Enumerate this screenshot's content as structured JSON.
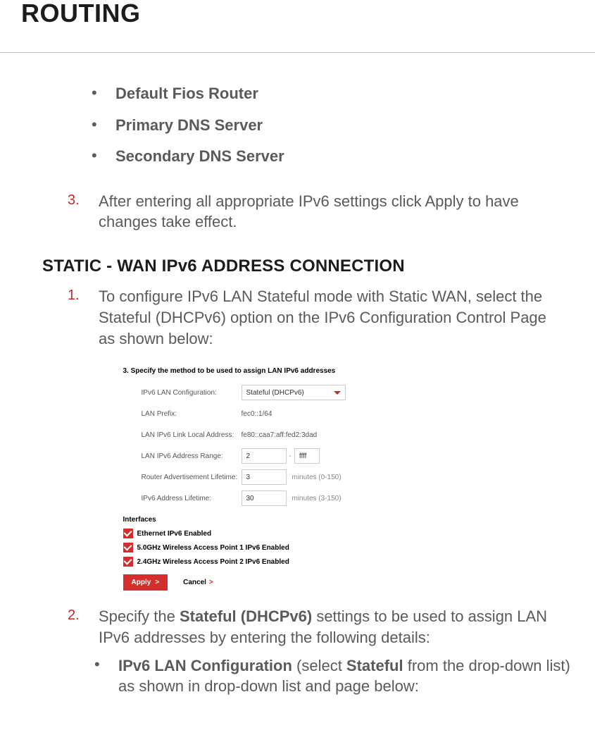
{
  "title": "ROUTING",
  "top_bullets": [
    "Default Fios Router",
    "Primary DNS Server",
    "Secondary DNS Server"
  ],
  "step3_num": "3.",
  "step3_text": "After entering all appropriate IPv6 settings click Apply to have changes take effect.",
  "subhead": "STATIC - WAN IPv6 ADDRESS CONNECTION",
  "step1_num": "1.",
  "step1_text": "To configure IPv6 LAN Stateful mode with Static WAN, select the Stateful (DHCPv6) option on the IPv6 Configuration Control Page as shown below:",
  "figure": {
    "title": "3. Specify the method to be used to assign LAN IPv6 addresses",
    "row_ipv6cfg_label": "IPv6 LAN Configuration:",
    "row_ipv6cfg_value": "Stateful (DHCPv6)",
    "row_lanprefix_label": "LAN Prefix:",
    "row_lanprefix_value": "fec0::1/64",
    "row_linklocal_label": "LAN IPv6 Link Local Address:",
    "row_linklocal_value": "fe80::caa7:aff:fed2:3dad",
    "row_range_label": "LAN IPv6 Address Range:",
    "row_range_start": "2",
    "row_range_end": "ffff",
    "row_ra_label": "Router Advertisement Lifetime:",
    "row_ra_value": "3",
    "row_ra_hint": "minutes (0-150)",
    "row_addrlife_label": "IPv6 Address Lifetime:",
    "row_addrlife_value": "30",
    "row_addrlife_hint": "minutes (3-150)",
    "interfaces_label": "Interfaces",
    "chk1": "Ethernet IPv6 Enabled",
    "chk2": "5.0GHz Wireless Access Point 1 IPv6 Enabled",
    "chk3": "2.4GHz Wireless Access Point 2 IPv6 Enabled",
    "apply": "Apply",
    "cancel": "Cancel"
  },
  "step2_num": "2.",
  "step2_pre": "Specify the ",
  "step2_bold": "Stateful (DHCPv6)",
  "step2_post": " settings to be used to assign LAN IPv6 addresses by entering the following details:",
  "step2_sub_bold1": "IPv6 LAN Configuration",
  "step2_sub_mid": " (select ",
  "step2_sub_bold2": "Stateful",
  "step2_sub_tail": " from the drop-down list) as shown in drop-down list and page below:"
}
